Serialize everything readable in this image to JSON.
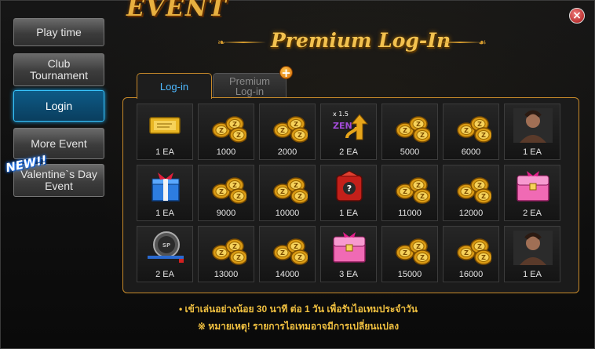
{
  "window": {
    "event_title": "EVENT",
    "close_label": "×",
    "header_title": "Premium Log-In"
  },
  "sidebar": {
    "items": [
      {
        "label": "Play time",
        "active": false
      },
      {
        "label": "Club\nTournament",
        "active": false
      },
      {
        "label": "Login",
        "active": true
      },
      {
        "label": "More Event",
        "active": false
      },
      {
        "label": "Valentine`s Day\nEvent",
        "active": false
      }
    ],
    "new_badge": "NEW!!"
  },
  "tabs": [
    {
      "label": "Log-in",
      "active": true
    },
    {
      "label": "Premium\nLog-in",
      "active": false
    }
  ],
  "plus_icon": "+",
  "rewards": [
    [
      {
        "icon": "zone-ticket-icon",
        "label": "1 EA"
      },
      {
        "icon": "zen-coins-icon",
        "label": "1000"
      },
      {
        "icon": "zen-coins-icon",
        "label": "2000"
      },
      {
        "icon": "zen-boost-icon",
        "label": "2 EA",
        "icon_text": "x 1.5"
      },
      {
        "icon": "zen-coins-icon",
        "label": "5000"
      },
      {
        "icon": "zen-coins-icon",
        "label": "6000"
      },
      {
        "icon": "character-portrait-icon",
        "label": "1 EA"
      }
    ],
    [
      {
        "icon": "gift-box-icon",
        "label": "1 EA"
      },
      {
        "icon": "zen-coins-icon",
        "label": "9000"
      },
      {
        "icon": "zen-coins-icon",
        "label": "10000"
      },
      {
        "icon": "mystery-box-icon",
        "label": "1 EA"
      },
      {
        "icon": "zen-coins-icon",
        "label": "11000"
      },
      {
        "icon": "zen-coins-icon",
        "label": "12000"
      },
      {
        "icon": "pink-treasure-chest-icon",
        "label": "2 EA"
      }
    ],
    [
      {
        "icon": "sp-scope-icon",
        "label": "2 EA"
      },
      {
        "icon": "zen-coins-icon",
        "label": "13000"
      },
      {
        "icon": "zen-coins-icon",
        "label": "14000"
      },
      {
        "icon": "pink-treasure-chest-icon",
        "label": "3 EA"
      },
      {
        "icon": "zen-coins-icon",
        "label": "15000"
      },
      {
        "icon": "zen-coins-icon",
        "label": "16000"
      },
      {
        "icon": "character-portrait-icon",
        "label": "1 EA"
      }
    ]
  ],
  "footer": {
    "line1": "• เข้าเล่นอย่างน้อย 30 นาที ต่อ 1 วัน เพื่อรับไอเทมประจำวัน",
    "line2": "※ หมายเหตุ! รายการไอเทมอาจมีการเปลี่ยนแปลง"
  },
  "colors": {
    "gold": "#f3c24f",
    "active_blue": "#38c6ff",
    "panel_border": "#c88a2a"
  }
}
